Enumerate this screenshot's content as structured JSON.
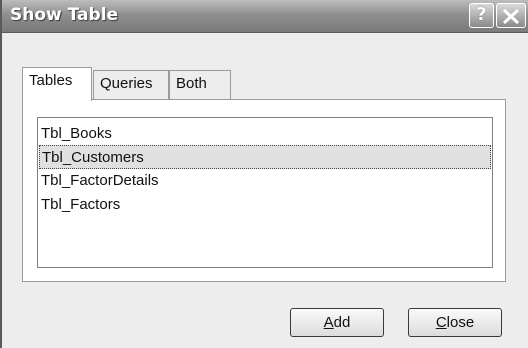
{
  "window": {
    "title": "Show Table",
    "help_label": "?"
  },
  "tabs": [
    {
      "label": "Tables",
      "active": true
    },
    {
      "label": "Queries",
      "active": false
    },
    {
      "label": "Both",
      "active": false
    }
  ],
  "list": {
    "items": [
      "Tbl_Books",
      "Tbl_Customers",
      "Tbl_FactorDetails",
      "Tbl_Factors"
    ],
    "selected_index": 1
  },
  "buttons": {
    "add": {
      "mnemonic": "A",
      "rest": "dd"
    },
    "close": {
      "mnemonic": "C",
      "rest": "lose"
    }
  },
  "icons": {
    "help": "question-mark-icon",
    "close": "close-x-icon"
  }
}
